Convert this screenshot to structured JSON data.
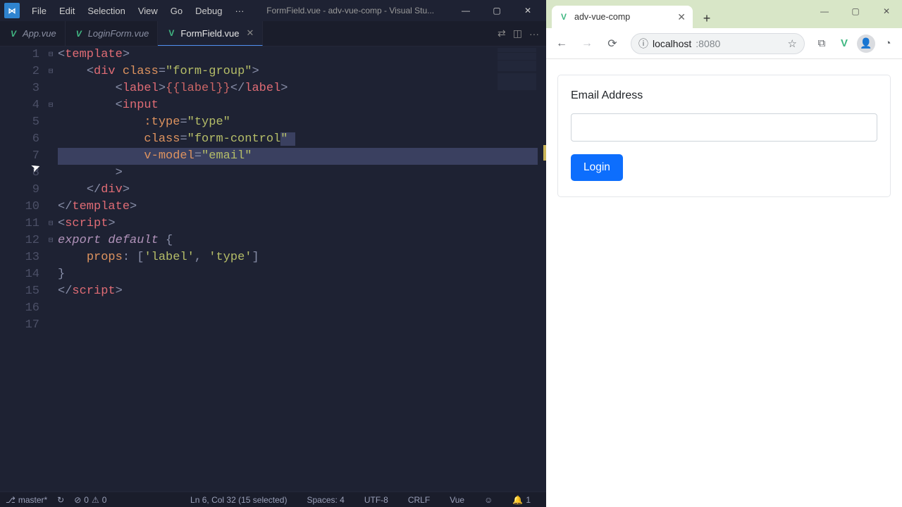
{
  "vscode": {
    "logo": "⋈",
    "menu": [
      "File",
      "Edit",
      "Selection",
      "View",
      "Go",
      "Debug",
      "···"
    ],
    "window_title": "FormField.vue - adv-vue-comp - Visual Stu...",
    "win_controls": {
      "min": "—",
      "max": "▢",
      "close": "✕"
    },
    "tabs": [
      {
        "icon": "V",
        "label": "App.vue",
        "active": false,
        "close": false
      },
      {
        "icon": "V",
        "label": "LoginForm.vue",
        "active": false,
        "close": false
      },
      {
        "icon": "V",
        "label": "FormField.vue",
        "active": true,
        "close": true
      }
    ],
    "tabs_right": {
      "compare": "⇄",
      "split": "◫",
      "more": "···"
    },
    "line_numbers": [
      "1",
      "2",
      "3",
      "4",
      "5",
      "6",
      "7",
      "8",
      "9",
      "10",
      "11",
      "12",
      "13",
      "14",
      "15",
      "16",
      "17"
    ],
    "fold_markers": {
      "l1": "⊟",
      "l2": "⊟",
      "l4": "⊟",
      "l11": "⊟",
      "l12": "⊟"
    },
    "code": {
      "l1": {
        "open": "<",
        "tag": "template",
        "close": ">"
      },
      "l2": {
        "indent": "    ",
        "open": "<",
        "tag": "div",
        "sp": " ",
        "attr": "class",
        "eq": "=",
        "q1": "\"",
        "val": "form-group",
        "q2": "\"",
        "close": ">"
      },
      "l3": {
        "indent": "        ",
        "open": "<",
        "tag": "label",
        "close1": ">",
        "inter_open": "{{",
        "inter_var": "label",
        "inter_close": "}}",
        "open2": "</",
        "tag2": "label",
        "close2": ">"
      },
      "l4": {
        "indent": "        ",
        "open": "<",
        "tag": "input"
      },
      "l5": {
        "indent": "            ",
        "attr": ":type",
        "eq": "=",
        "q1": "\"",
        "val": "type",
        "q2": "\""
      },
      "l6": {
        "indent": "            ",
        "attr": "class",
        "eq": "=",
        "q1": "\"",
        "val": "form-control",
        "q2": "\""
      },
      "l7": {
        "indent": "            ",
        "attr": "v-model",
        "eq": "=",
        "q1": "\"",
        "val": "email",
        "q2": "\""
      },
      "l8": {
        "indent": "        ",
        "close": ">"
      },
      "l9": {
        "indent": "    ",
        "open": "</",
        "tag": "div",
        "close": ">"
      },
      "l10": {
        "open": "</",
        "tag": "template",
        "close": ">"
      },
      "l11": {
        "open": "<",
        "tag": "script",
        "close": ">"
      },
      "l12": {
        "kw1": "export",
        "sp1": " ",
        "kw2": "default",
        "sp2": " ",
        "brace": "{"
      },
      "l13": {
        "indent": "    ",
        "ident": "props",
        "colon": ": ",
        "lb": "[",
        "q1": "'",
        "v1": "label",
        "q2": "'",
        "comma": ", ",
        "q3": "'",
        "v2": "type",
        "q4": "'",
        "rb": "]"
      },
      "l14": {
        "brace": "}"
      },
      "l15": {
        "open": "</",
        "tag": "script",
        "close": ">"
      }
    },
    "status": {
      "branch_icon": "⎇",
      "branch": "master*",
      "sync_icon": "↻",
      "errors_icon": "⊘",
      "errors": "0",
      "warnings_icon": "⚠",
      "warnings": "0",
      "cursor": "Ln 6, Col 32 (15 selected)",
      "spaces": "Spaces: 4",
      "encoding": "UTF-8",
      "eol": "CRLF",
      "lang": "Vue",
      "feedback_icon": "☺",
      "bell_icon": "🔔",
      "notif": "1"
    }
  },
  "browser": {
    "tab": {
      "favicon": "V",
      "title": "adv-vue-comp",
      "close": "✕"
    },
    "newtab": "+",
    "win_controls": {
      "min": "—",
      "max": "▢",
      "close": "✕"
    },
    "toolbar": {
      "back": "←",
      "forward": "→",
      "reload": "⟳",
      "info_icon": "ⓘ",
      "host": "localhost",
      "port": ":8080",
      "star": "☆",
      "ext1": "⧉",
      "ext2": "V",
      "avatar": "👤",
      "data_saver": "◔"
    },
    "page": {
      "label": "Email Address",
      "input_value": "",
      "button": "Login"
    }
  }
}
